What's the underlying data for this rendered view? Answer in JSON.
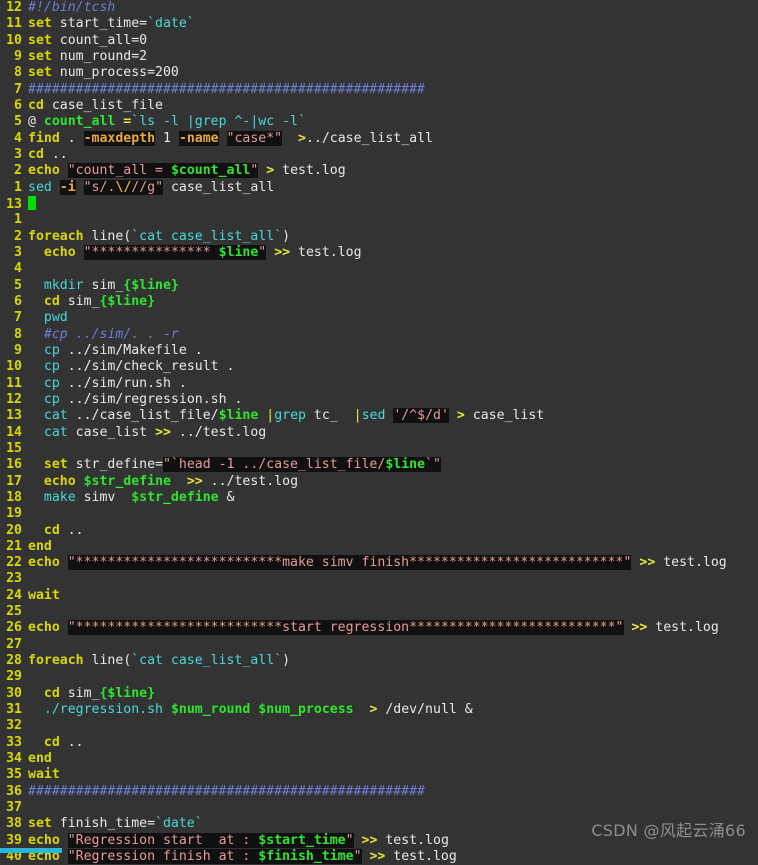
{
  "app": {
    "kind": "terminal-text-editor",
    "theme": "dark",
    "background": "#333333",
    "watermark": "CSDN @风起云涌66"
  },
  "colors": {
    "background": "#333333",
    "string_background": "#101010",
    "keyword": "#d8d800",
    "command": "#48d8d8",
    "comment": "#6b7fd7",
    "string": "#e89a9a",
    "variable": "#2ee62e",
    "option": "#e8a838",
    "redirect": "#e8e838",
    "line_number": "#d8d800",
    "cursor": "#00e000",
    "watermark": "#8e8e8e"
  },
  "editor": {
    "line_number_mode": "relative",
    "current_line_number": "13",
    "cursor_visible": true
  },
  "lines": [
    {
      "num": "12",
      "tokens": [
        {
          "t": "comment",
          "v": "#!/bin/tcsh"
        }
      ]
    },
    {
      "num": "11",
      "tokens": [
        {
          "t": "kw",
          "v": "set"
        },
        {
          "t": "plain",
          "v": " start_time="
        },
        {
          "t": "bq",
          "v": "`date`"
        }
      ]
    },
    {
      "num": "10",
      "tokens": [
        {
          "t": "kw",
          "v": "set"
        },
        {
          "t": "plain",
          "v": " count_all=0"
        }
      ]
    },
    {
      "num": "9",
      "tokens": [
        {
          "t": "kw",
          "v": "set"
        },
        {
          "t": "plain",
          "v": " num_round=2"
        }
      ]
    },
    {
      "num": "8",
      "tokens": [
        {
          "t": "kw",
          "v": "set"
        },
        {
          "t": "plain",
          "v": " num_process=200"
        }
      ]
    },
    {
      "num": "7",
      "tokens": [
        {
          "t": "comment",
          "v": "##################################################"
        }
      ]
    },
    {
      "num": "6",
      "tokens": [
        {
          "t": "kw",
          "v": "cd"
        },
        {
          "t": "plain",
          "v": " case_list_file"
        }
      ]
    },
    {
      "num": "5",
      "tokens": [
        {
          "t": "at",
          "v": "@ "
        },
        {
          "t": "varp",
          "v": "count_all"
        },
        {
          "t": "redir",
          "v": " ="
        },
        {
          "t": "bq",
          "v": "`ls -l |grep ^-|wc -l`"
        }
      ]
    },
    {
      "num": "4",
      "tokens": [
        {
          "t": "kw",
          "v": "find"
        },
        {
          "t": "plain",
          "v": " . "
        },
        {
          "t": "opt",
          "v": "-maxdepth"
        },
        {
          "t": "plain",
          "v": " 1 "
        },
        {
          "t": "opt",
          "v": "-name"
        },
        {
          "t": "plain",
          "v": " "
        },
        {
          "t": "str",
          "v": "\"case*\""
        },
        {
          "t": "plain",
          "v": "  "
        },
        {
          "t": "redir",
          "v": ">"
        },
        {
          "t": "plain",
          "v": "../case_list_all"
        }
      ]
    },
    {
      "num": "3",
      "tokens": [
        {
          "t": "kw",
          "v": "cd"
        },
        {
          "t": "plain",
          "v": " .."
        }
      ]
    },
    {
      "num": "2",
      "tokens": [
        {
          "t": "kw",
          "v": "echo"
        },
        {
          "t": "plain",
          "v": " "
        },
        {
          "t": "str",
          "v": "\"count_all = "
        },
        {
          "t": "var",
          "v": "$count_all"
        },
        {
          "t": "str",
          "v": "\""
        },
        {
          "t": "plain",
          "v": " "
        },
        {
          "t": "redir",
          "v": ">"
        },
        {
          "t": "plain",
          "v": " test.log"
        }
      ]
    },
    {
      "num": "1",
      "tokens": [
        {
          "t": "cmd",
          "v": "sed"
        },
        {
          "t": "plain",
          "v": " "
        },
        {
          "t": "opt",
          "v": "-i"
        },
        {
          "t": "plain",
          "v": " "
        },
        {
          "t": "str",
          "v": "\"s/."
        },
        {
          "t": "opt",
          "v": "\\/"
        },
        {
          "t": "str",
          "v": "//g\""
        },
        {
          "t": "plain",
          "v": " case_list_all"
        }
      ]
    },
    {
      "num": "13",
      "current": true,
      "tokens": [
        {
          "t": "cursor",
          "v": " "
        }
      ]
    },
    {
      "num": "1",
      "tokens": []
    },
    {
      "num": "2",
      "tokens": [
        {
          "t": "kw",
          "v": "foreach"
        },
        {
          "t": "plain",
          "v": " line("
        },
        {
          "t": "bq",
          "v": "`cat case_list_all`"
        },
        {
          "t": "plain",
          "v": ")"
        }
      ]
    },
    {
      "num": "3",
      "tokens": [
        {
          "t": "plain",
          "v": "  "
        },
        {
          "t": "kw",
          "v": "echo"
        },
        {
          "t": "plain",
          "v": " "
        },
        {
          "t": "str",
          "v": "\"*************** "
        },
        {
          "t": "var",
          "v": "$line"
        },
        {
          "t": "str",
          "v": "\""
        },
        {
          "t": "plain",
          "v": " "
        },
        {
          "t": "redir",
          "v": ">>"
        },
        {
          "t": "plain",
          "v": " test.log"
        }
      ]
    },
    {
      "num": "4",
      "tokens": []
    },
    {
      "num": "5",
      "tokens": [
        {
          "t": "plain",
          "v": "  "
        },
        {
          "t": "cmd",
          "v": "mkdir"
        },
        {
          "t": "plain",
          "v": " sim_"
        },
        {
          "t": "varp",
          "v": "{$line}"
        }
      ]
    },
    {
      "num": "6",
      "tokens": [
        {
          "t": "plain",
          "v": "  "
        },
        {
          "t": "kw",
          "v": "cd"
        },
        {
          "t": "plain",
          "v": " sim_"
        },
        {
          "t": "varp",
          "v": "{$line}"
        }
      ]
    },
    {
      "num": "7",
      "tokens": [
        {
          "t": "plain",
          "v": "  "
        },
        {
          "t": "cmd",
          "v": "pwd"
        }
      ]
    },
    {
      "num": "8",
      "tokens": [
        {
          "t": "plain",
          "v": "  "
        },
        {
          "t": "comment",
          "v": "#cp ../sim/. . -r"
        }
      ]
    },
    {
      "num": "9",
      "tokens": [
        {
          "t": "plain",
          "v": "  "
        },
        {
          "t": "cmd",
          "v": "cp"
        },
        {
          "t": "plain",
          "v": " ../sim/Makefile ."
        }
      ]
    },
    {
      "num": "10",
      "tokens": [
        {
          "t": "plain",
          "v": "  "
        },
        {
          "t": "cmd",
          "v": "cp"
        },
        {
          "t": "plain",
          "v": " ../sim/check_result ."
        }
      ]
    },
    {
      "num": "11",
      "tokens": [
        {
          "t": "plain",
          "v": "  "
        },
        {
          "t": "cmd",
          "v": "cp"
        },
        {
          "t": "plain",
          "v": " ../sim/run.sh ."
        }
      ]
    },
    {
      "num": "12",
      "tokens": [
        {
          "t": "plain",
          "v": "  "
        },
        {
          "t": "cmd",
          "v": "cp"
        },
        {
          "t": "plain",
          "v": " ../sim/regression.sh ."
        }
      ]
    },
    {
      "num": "13",
      "tokens": [
        {
          "t": "plain",
          "v": "  "
        },
        {
          "t": "cmd",
          "v": "cat"
        },
        {
          "t": "plain",
          "v": " ../case_list_file/"
        },
        {
          "t": "varp",
          "v": "$line"
        },
        {
          "t": "plain",
          "v": " "
        },
        {
          "t": "pipe",
          "v": "|"
        },
        {
          "t": "cmd",
          "v": "grep"
        },
        {
          "t": "plain",
          "v": " tc_ "
        },
        {
          "t": "plain",
          "v": " "
        },
        {
          "t": "pipe",
          "v": "|"
        },
        {
          "t": "cmd",
          "v": "sed"
        },
        {
          "t": "plain",
          "v": " "
        },
        {
          "t": "str",
          "v": "'/^$/d'"
        },
        {
          "t": "plain",
          "v": " "
        },
        {
          "t": "redir",
          "v": ">"
        },
        {
          "t": "plain",
          "v": " case_list"
        }
      ]
    },
    {
      "num": "14",
      "tokens": [
        {
          "t": "plain",
          "v": "  "
        },
        {
          "t": "cmd",
          "v": "cat"
        },
        {
          "t": "plain",
          "v": " case_list "
        },
        {
          "t": "redir",
          "v": ">>"
        },
        {
          "t": "plain",
          "v": " ../test.log"
        }
      ]
    },
    {
      "num": "15",
      "tokens": []
    },
    {
      "num": "16",
      "tokens": [
        {
          "t": "plain",
          "v": "  "
        },
        {
          "t": "kw",
          "v": "set"
        },
        {
          "t": "plain",
          "v": " str_define="
        },
        {
          "t": "str",
          "v": "\"`head -1 ../case_list_file/"
        },
        {
          "t": "var",
          "v": "$line"
        },
        {
          "t": "str",
          "v": "`\""
        }
      ]
    },
    {
      "num": "17",
      "tokens": [
        {
          "t": "plain",
          "v": "  "
        },
        {
          "t": "kw",
          "v": "echo"
        },
        {
          "t": "plain",
          "v": " "
        },
        {
          "t": "varp",
          "v": "$str_define"
        },
        {
          "t": "plain",
          "v": "  "
        },
        {
          "t": "redir",
          "v": ">>"
        },
        {
          "t": "plain",
          "v": " ../test.log"
        }
      ]
    },
    {
      "num": "18",
      "tokens": [
        {
          "t": "plain",
          "v": "  "
        },
        {
          "t": "cmd",
          "v": "make"
        },
        {
          "t": "plain",
          "v": " simv  "
        },
        {
          "t": "varp",
          "v": "$str_define"
        },
        {
          "t": "plain",
          "v": " &"
        }
      ]
    },
    {
      "num": "19",
      "tokens": []
    },
    {
      "num": "20",
      "tokens": [
        {
          "t": "plain",
          "v": "  "
        },
        {
          "t": "kw",
          "v": "cd"
        },
        {
          "t": "plain",
          "v": " .."
        }
      ]
    },
    {
      "num": "21",
      "tokens": [
        {
          "t": "kw",
          "v": "end"
        }
      ]
    },
    {
      "num": "22",
      "tokens": [
        {
          "t": "kw",
          "v": "echo"
        },
        {
          "t": "plain",
          "v": " "
        },
        {
          "t": "str",
          "v": "\"**************************make simv finish***************************\""
        },
        {
          "t": "plain",
          "v": " "
        },
        {
          "t": "redir",
          "v": ">>"
        },
        {
          "t": "plain",
          "v": " test.log"
        }
      ]
    },
    {
      "num": "23",
      "tokens": []
    },
    {
      "num": "24",
      "tokens": [
        {
          "t": "kw",
          "v": "wait"
        }
      ]
    },
    {
      "num": "25",
      "tokens": []
    },
    {
      "num": "26",
      "tokens": [
        {
          "t": "kw",
          "v": "echo"
        },
        {
          "t": "plain",
          "v": " "
        },
        {
          "t": "str",
          "v": "\"**************************start regression**************************\""
        },
        {
          "t": "plain",
          "v": " "
        },
        {
          "t": "redir",
          "v": ">>"
        },
        {
          "t": "plain",
          "v": " test.log"
        }
      ]
    },
    {
      "num": "27",
      "tokens": []
    },
    {
      "num": "28",
      "tokens": [
        {
          "t": "kw",
          "v": "foreach"
        },
        {
          "t": "plain",
          "v": " line("
        },
        {
          "t": "bq",
          "v": "`cat case_list_all`"
        },
        {
          "t": "plain",
          "v": ")"
        }
      ]
    },
    {
      "num": "29",
      "tokens": []
    },
    {
      "num": "30",
      "tokens": [
        {
          "t": "plain",
          "v": "  "
        },
        {
          "t": "kw",
          "v": "cd"
        },
        {
          "t": "plain",
          "v": " sim_"
        },
        {
          "t": "varp",
          "v": "{$line}"
        }
      ]
    },
    {
      "num": "31",
      "tokens": [
        {
          "t": "plain",
          "v": "  "
        },
        {
          "t": "cmd",
          "v": "./regression.sh"
        },
        {
          "t": "plain",
          "v": " "
        },
        {
          "t": "varp",
          "v": "$num_round"
        },
        {
          "t": "plain",
          "v": " "
        },
        {
          "t": "varp",
          "v": "$num_process"
        },
        {
          "t": "plain",
          "v": "  "
        },
        {
          "t": "redir",
          "v": ">"
        },
        {
          "t": "plain",
          "v": " /dev/null &"
        }
      ]
    },
    {
      "num": "32",
      "tokens": []
    },
    {
      "num": "33",
      "tokens": [
        {
          "t": "plain",
          "v": "  "
        },
        {
          "t": "kw",
          "v": "cd"
        },
        {
          "t": "plain",
          "v": " .."
        }
      ]
    },
    {
      "num": "34",
      "tokens": [
        {
          "t": "kw",
          "v": "end"
        }
      ]
    },
    {
      "num": "35",
      "tokens": [
        {
          "t": "kw",
          "v": "wait"
        }
      ]
    },
    {
      "num": "36",
      "tokens": [
        {
          "t": "comment",
          "v": "##################################################"
        }
      ]
    },
    {
      "num": "37",
      "tokens": []
    },
    {
      "num": "38",
      "tokens": [
        {
          "t": "kw",
          "v": "set"
        },
        {
          "t": "plain",
          "v": " finish_time="
        },
        {
          "t": "bq",
          "v": "`date`"
        }
      ]
    },
    {
      "num": "39",
      "tokens": [
        {
          "t": "kw",
          "v": "echo"
        },
        {
          "t": "plain",
          "v": " "
        },
        {
          "t": "str",
          "v": "\"Regression start  at : "
        },
        {
          "t": "var",
          "v": "$start_time"
        },
        {
          "t": "str",
          "v": "\""
        },
        {
          "t": "plain",
          "v": " "
        },
        {
          "t": "redir",
          "v": ">>"
        },
        {
          "t": "plain",
          "v": " test.log"
        }
      ]
    },
    {
      "num": "40",
      "tokens": [
        {
          "t": "kw",
          "v": "echo"
        },
        {
          "t": "plain",
          "v": " "
        },
        {
          "t": "str",
          "v": "\"Regression finish at : "
        },
        {
          "t": "var",
          "v": "$finish_time"
        },
        {
          "t": "str",
          "v": "\""
        },
        {
          "t": "plain",
          "v": " "
        },
        {
          "t": "redir",
          "v": ">>"
        },
        {
          "t": "plain",
          "v": " test.log"
        }
      ]
    }
  ]
}
